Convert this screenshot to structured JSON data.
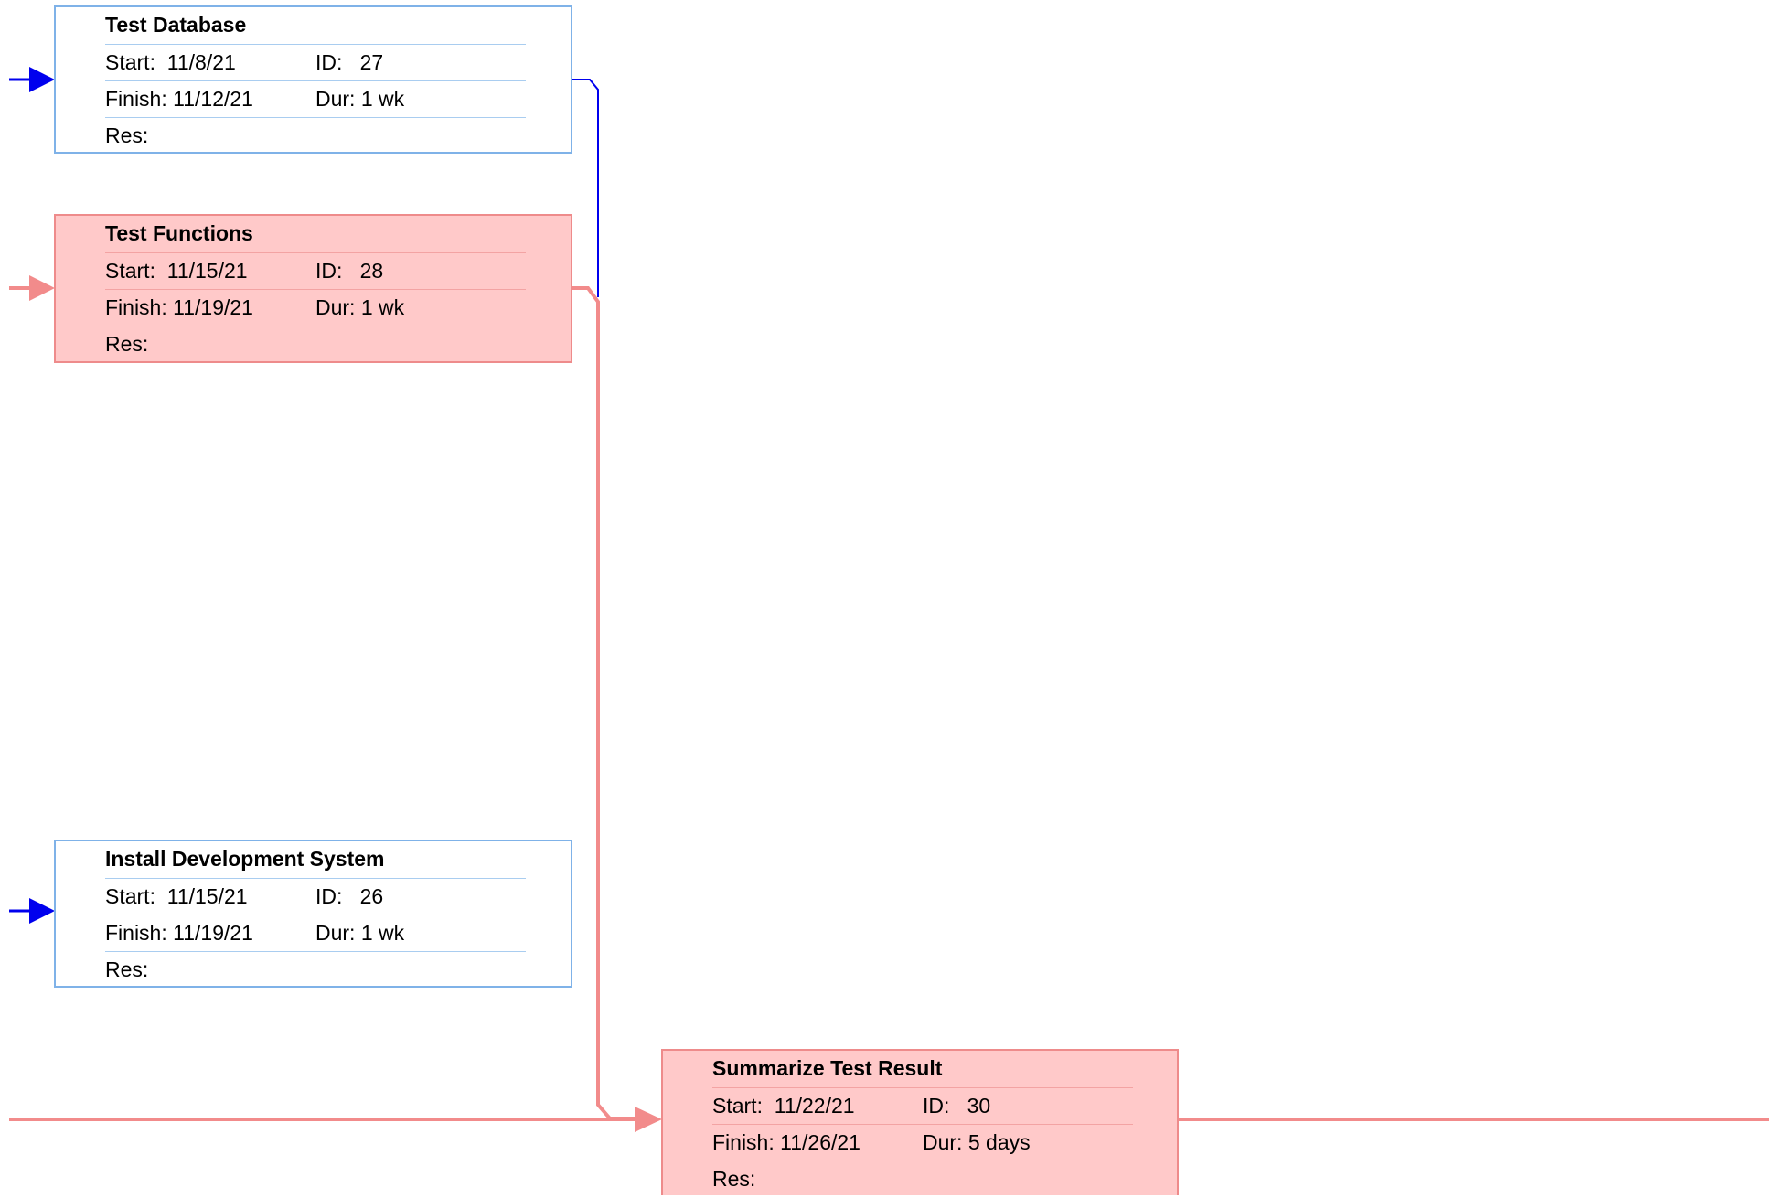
{
  "tasks": [
    {
      "name": "Test Database",
      "start_label": "Start:",
      "start": "11/8/21",
      "id_label": "ID:",
      "id": "27",
      "finish_label": "Finish:",
      "finish": "11/12/21",
      "dur_label": "Dur:",
      "dur": "1 wk",
      "res_label": "Res:",
      "critical": false
    },
    {
      "name": "Test Functions",
      "start_label": "Start:",
      "start": "11/15/21",
      "id_label": "ID:",
      "id": "28",
      "finish_label": "Finish:",
      "finish": "11/19/21",
      "dur_label": "Dur:",
      "dur": "1 wk",
      "res_label": "Res:",
      "critical": true
    },
    {
      "name": "Install Development System",
      "start_label": "Start:",
      "start": "11/15/21",
      "id_label": "ID:",
      "id": "26",
      "finish_label": "Finish:",
      "finish": "11/19/21",
      "dur_label": "Dur:",
      "dur": "1 wk",
      "res_label": "Res:",
      "critical": false
    },
    {
      "name": "Summarize Test Result",
      "start_label": "Start:",
      "start": "11/22/21",
      "id_label": "ID:",
      "id": "30",
      "finish_label": "Finish:",
      "finish": "11/26/21",
      "dur_label": "Dur:",
      "dur": "5 days",
      "res_label": "Res:",
      "critical": true
    }
  ],
  "colors": {
    "normal_border": "#7fb2e8",
    "critical_border": "#ee8b8b",
    "critical_fill": "#ffc9c9",
    "normal_link": "#0000ee",
    "critical_link": "#f28b8b"
  }
}
